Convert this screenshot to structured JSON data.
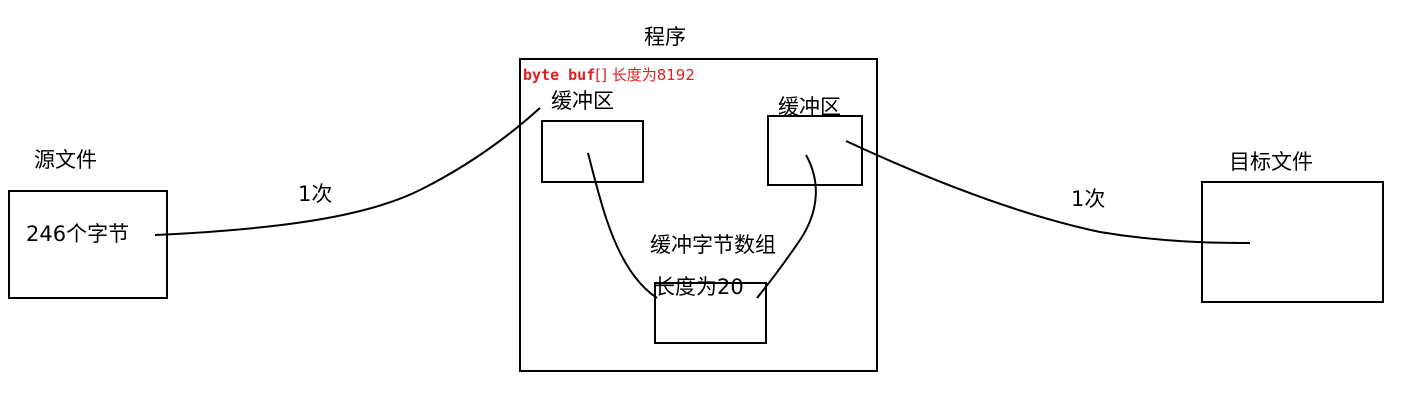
{
  "source": {
    "title": "源文件",
    "content": "246个字节"
  },
  "program": {
    "title": "程序",
    "buffer_decl_code": "byte buf",
    "buffer_decl_rest": "[] 长度为8192",
    "input_buffer_label": "缓冲区",
    "output_buffer_label": "缓冲区",
    "byte_array_label": "缓冲字节数组",
    "byte_array_length": "长度为20"
  },
  "target": {
    "title": "目标文件"
  },
  "arrows": {
    "read_count": "1次",
    "write_count": "1次"
  },
  "colors": {
    "stroke": "#000000",
    "highlight": "#e02020"
  }
}
